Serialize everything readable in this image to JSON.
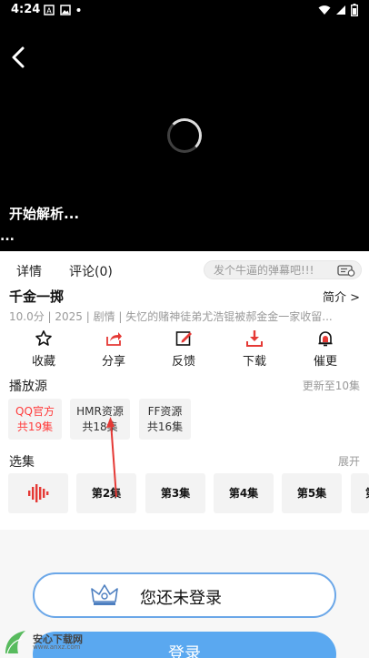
{
  "status": {
    "time": "4:24"
  },
  "player": {
    "parse_text": "开始解析...",
    "dots": "..."
  },
  "tabs": [
    {
      "label": "详情"
    },
    {
      "label": "评论(0)"
    }
  ],
  "danmaku": {
    "placeholder": "发个牛逼的弹幕吧!!!"
  },
  "drama": {
    "title": "千金一掷",
    "intro_label": "简介 >",
    "meta": "10.0分  | 2025  |  剧情  |  失忆的赌神徒弟尤浩锟被郝金金一家收留..."
  },
  "actions": [
    {
      "icon": "star-icon",
      "label": "收藏"
    },
    {
      "icon": "share-icon",
      "label": "分享"
    },
    {
      "icon": "feedback-icon",
      "label": "反馈"
    },
    {
      "icon": "download-icon",
      "label": "下载"
    },
    {
      "icon": "bell-icon",
      "label": "催更"
    }
  ],
  "sources": {
    "title": "播放源",
    "update": "更新至10集",
    "items": [
      {
        "name": "QQ官方",
        "count": "共19集",
        "active": true
      },
      {
        "name": "HMR资源",
        "count": "共18集",
        "active": false
      },
      {
        "name": "FF资源",
        "count": "共16集",
        "active": false
      }
    ]
  },
  "episodes": {
    "title": "选集",
    "expand": "展开",
    "items": [
      "第2集",
      "第3集",
      "第4集",
      "第5集",
      "第"
    ]
  },
  "login": {
    "prompt": "您还未登录",
    "button": "登录"
  },
  "watermark": {
    "title": "安心下载网",
    "url": "www.anxz.com"
  },
  "colors": {
    "accent_red": "#ff3b3b",
    "login_blue": "#5aa8f0",
    "login_border": "#6ba7e8",
    "arrow_red": "#e53935"
  }
}
